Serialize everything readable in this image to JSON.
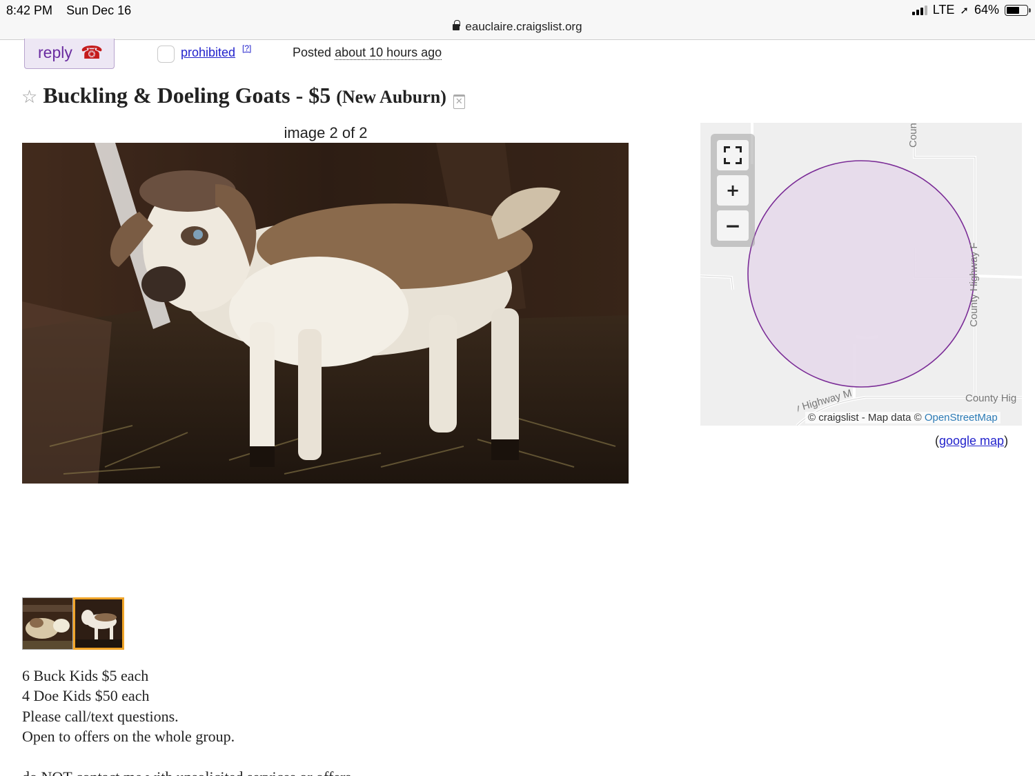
{
  "status_bar": {
    "time": "8:42 PM",
    "date": "Sun Dec 16",
    "network": "LTE",
    "battery": "64%",
    "battery_level": 0.64,
    "signal_bars_filled": 3
  },
  "browser": {
    "url": "eauclaire.craigslist.org"
  },
  "actions": {
    "reply_label": "reply",
    "reply_icon": "telephone-icon",
    "prohibited_label": "prohibited",
    "help_label": "[?]",
    "posted_label": "Posted",
    "posted_ago": "about 10 hours ago"
  },
  "posting": {
    "title": "Buckling & Doeling Goats",
    "price": "- $5",
    "location": "(New Auburn)",
    "body_lines": [
      "6 Buck Kids $5 each",
      "4 Doe Kids $50 each",
      "Please call/text questions.",
      "Open to offers on the whole group."
    ],
    "cutoff_line": "do NOT contact me with unsolicited services or offers"
  },
  "gallery": {
    "caption": "image 2 of 2",
    "current_index": 2,
    "total": 2
  },
  "map": {
    "road_labels": [
      "Coun",
      "County Highway F",
      "County Highway M",
      "County Hig"
    ],
    "attribution_prefix": "© craigslist - Map data ©",
    "attribution_link": "OpenStreetMap",
    "google_link_open": "(",
    "google_link": "google map",
    "google_link_close": ")",
    "circle_color": "#e6d9ea",
    "circle_stroke": "#7a2b96"
  },
  "colors": {
    "link": "#2222cc",
    "reply_text": "#6a2ca0",
    "thumb_active_border": "#f0a428"
  }
}
